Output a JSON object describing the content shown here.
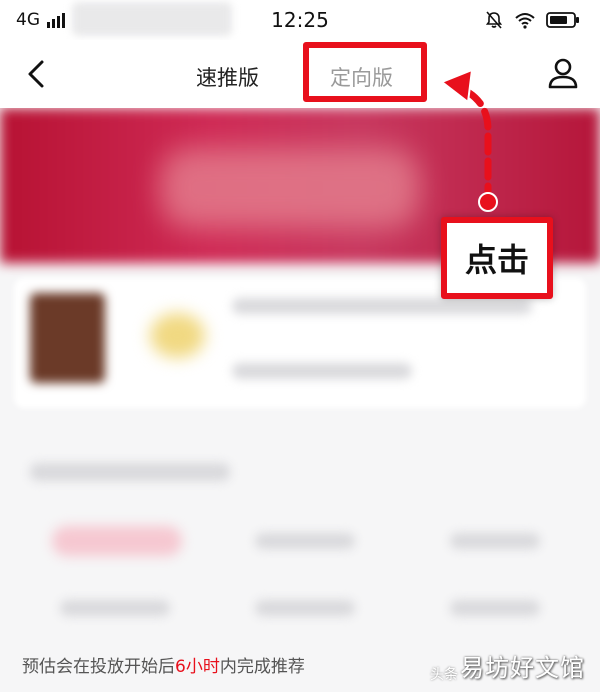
{
  "status_bar": {
    "network": "4G",
    "time": "12:25"
  },
  "nav": {
    "tab_fast": "速推版",
    "tab_targeted": "定向版"
  },
  "annotation": {
    "callout_label": "点击"
  },
  "bottom_note": {
    "before": "预估会在投放开始后",
    "highlight": "6小时",
    "after": "内完成推荐"
  },
  "watermark": {
    "main": "易坊好文馆",
    "sub": "头条"
  },
  "colors": {
    "annotation_red": "#e8101c",
    "banner_red": "#c8385f"
  }
}
